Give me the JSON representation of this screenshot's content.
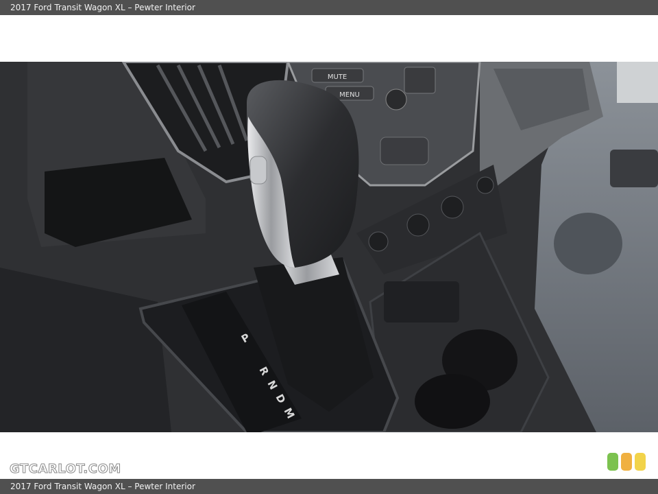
{
  "header": {
    "caption": "2017 Ford Transit Wagon XL – Pewter Interior"
  },
  "footer": {
    "caption": "2017 Ford Transit Wagon XL – Pewter Interior"
  },
  "branding": {
    "logo_text": "GTCARLOT.COM"
  },
  "photo": {
    "subject": "automatic-gear-shifter-console",
    "dash_labels": {
      "mute": "MUTE",
      "menu": "MENU"
    },
    "gear_letters": [
      "P",
      "R",
      "N",
      "D",
      "M"
    ]
  },
  "rating_badges": [
    {
      "color": "#7cc24f"
    },
    {
      "color": "#f0b040"
    },
    {
      "color": "#f2d34a"
    }
  ]
}
